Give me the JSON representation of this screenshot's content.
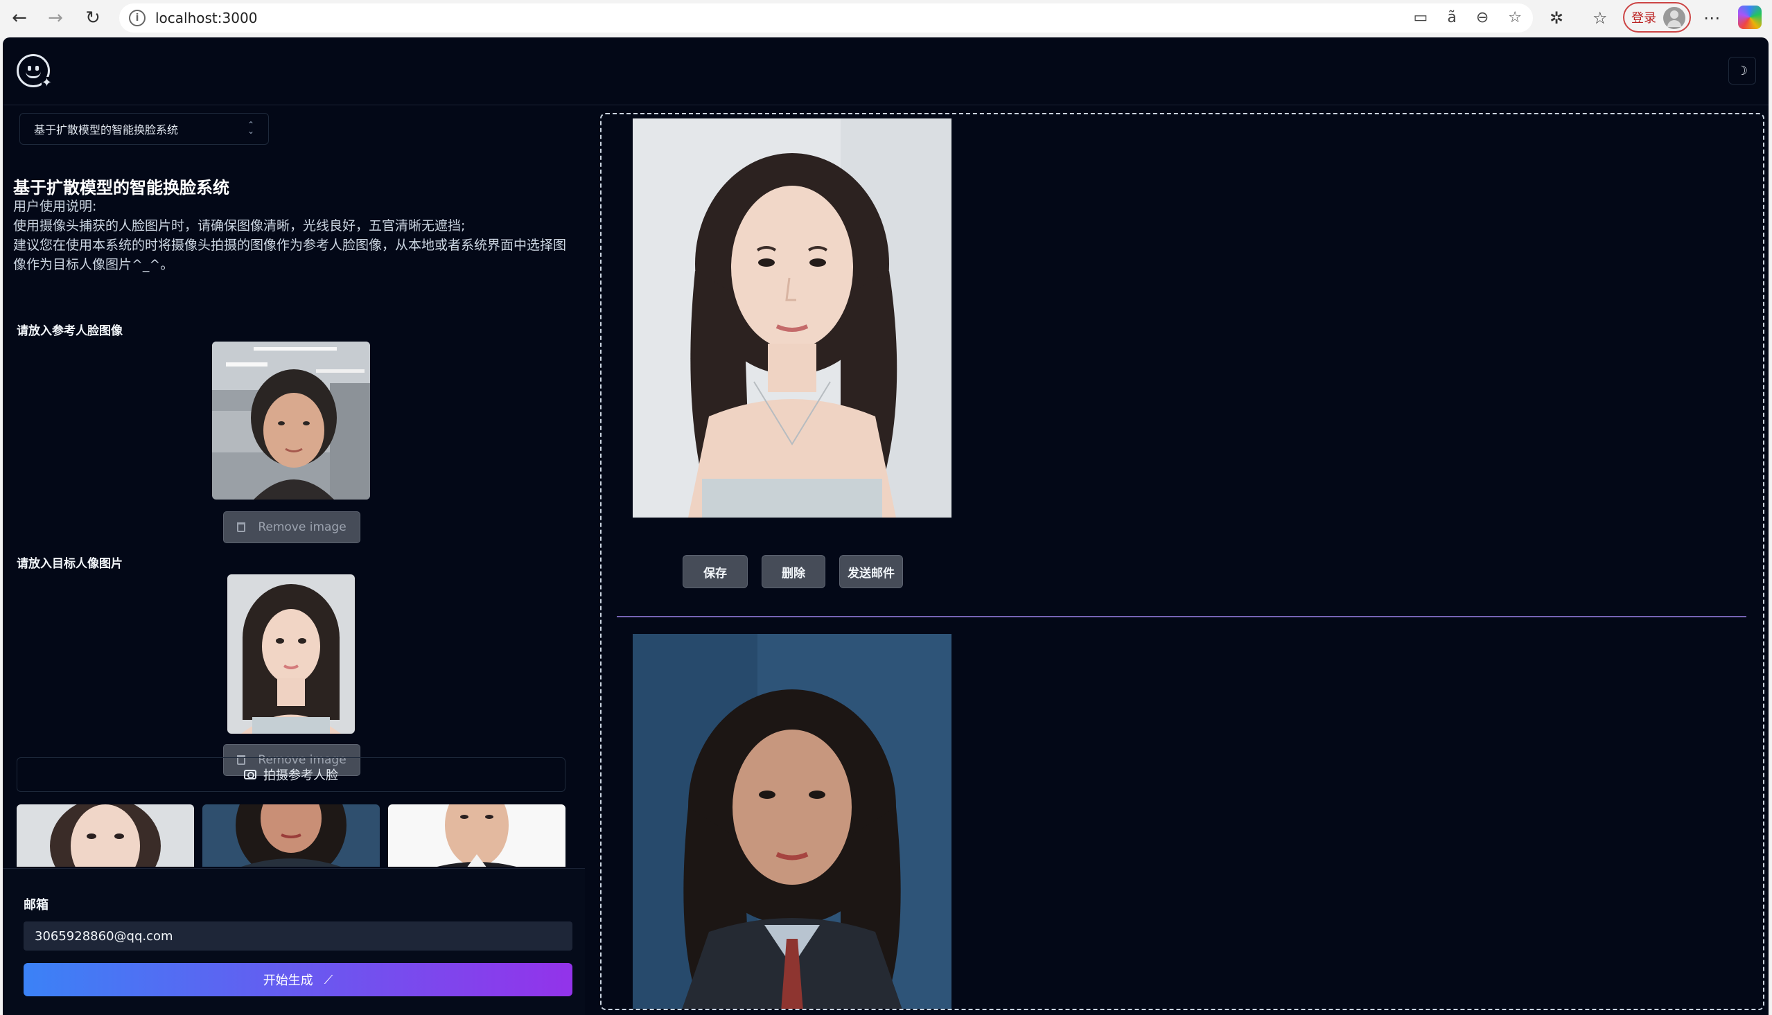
{
  "browser": {
    "url": "localhost:3000",
    "login_label": "登录"
  },
  "app": {
    "model_select": "基于扩散模型的智能换脸系统",
    "title": "基于扩散模型的智能换脸系统",
    "instructions": [
      "用户使用说明:",
      "使用摄像头捕获的人脸图片时，请确保图像清晰，光线良好，五官清晰无遮挡;",
      "建议您在使用本系统的时将摄像头拍摄的图像作为参考人脸图像，从本地或者系统界面中选择图像作为目标人像图片^_^。"
    ],
    "reference_label": "请放入参考人脸图像",
    "target_label": "请放入目标人像图片",
    "remove_image_label": "Remove image",
    "capture_label": "拍摄参考人脸",
    "email_label": "邮箱",
    "email_value": "3065928860@qq.com",
    "generate_label": "开始生成"
  },
  "result": {
    "save_label": "保存",
    "delete_label": "删除",
    "send_email_label": "发送邮件"
  },
  "colors": {
    "app_bg": "#030817",
    "button_gray": "#464c58",
    "gradient_start": "#3b82f6",
    "gradient_end": "#9333ea",
    "divider": "#a78bfa"
  },
  "icons": [
    "back-icon",
    "forward-icon",
    "refresh-icon",
    "info-icon",
    "camera-icon",
    "trash-icon",
    "wand-icon",
    "theme-toggle-icon",
    "app-logo-icon"
  ]
}
